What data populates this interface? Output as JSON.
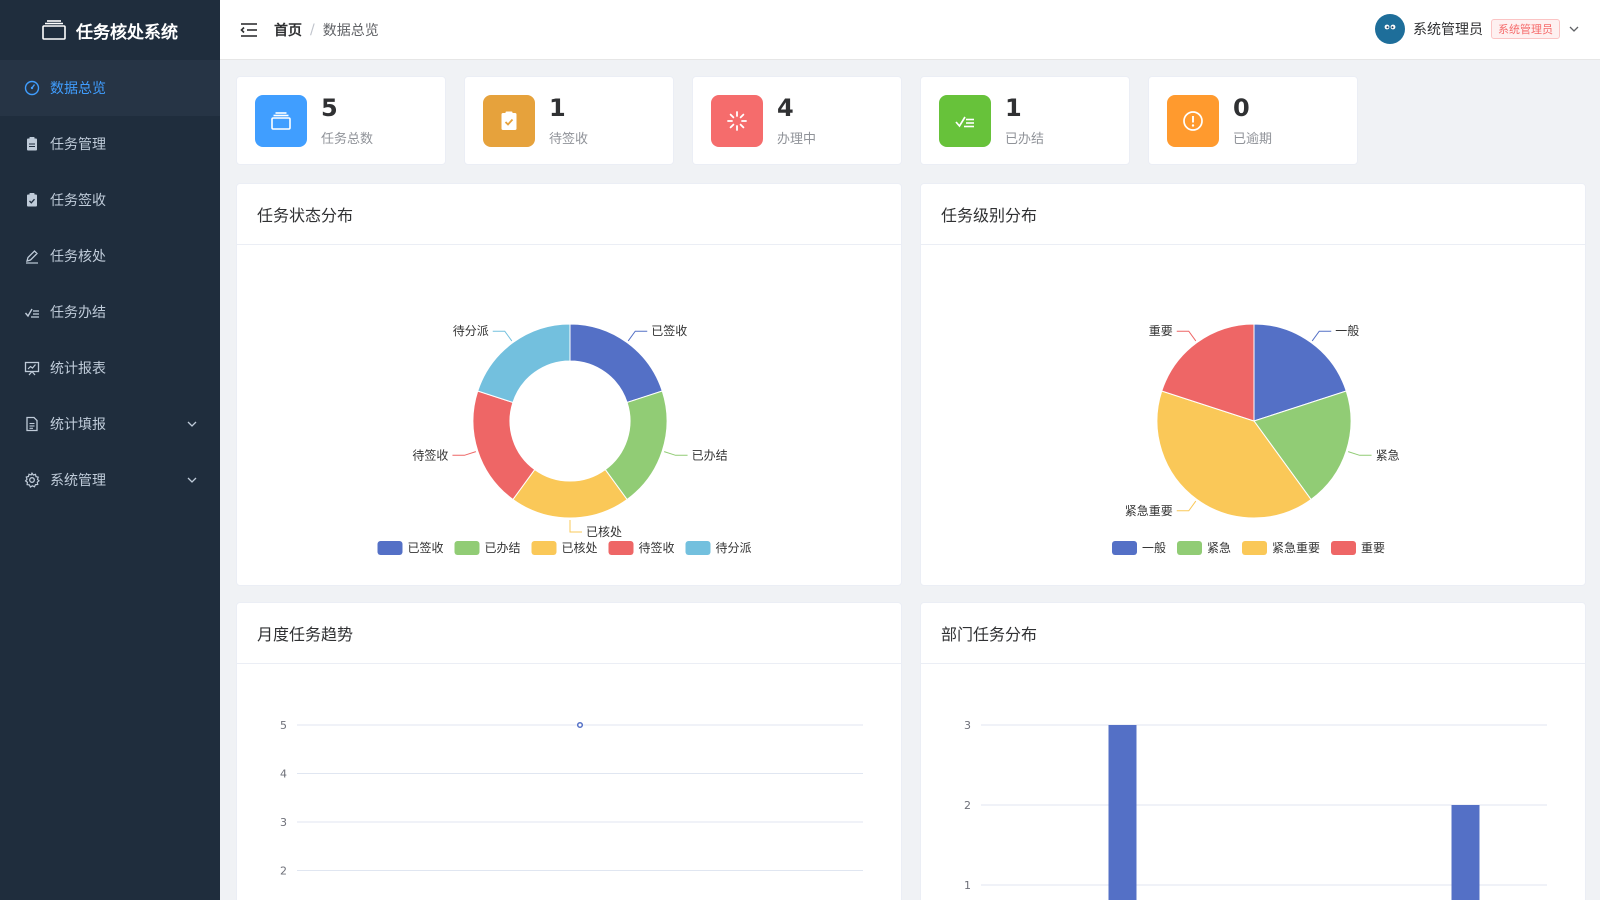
{
  "app": {
    "title": "任务核处系统"
  },
  "sidebar": {
    "items": [
      {
        "label": "数据总览",
        "icon": "dashboard-icon",
        "active": true
      },
      {
        "label": "任务管理",
        "icon": "clipboard-icon"
      },
      {
        "label": "任务签收",
        "icon": "clipboard-check-icon"
      },
      {
        "label": "任务核处",
        "icon": "edit-pen-icon"
      },
      {
        "label": "任务办结",
        "icon": "checklist-icon"
      },
      {
        "label": "统计报表",
        "icon": "presentation-chart-icon"
      },
      {
        "label": "统计填报",
        "icon": "document-icon",
        "expandable": true
      },
      {
        "label": "系统管理",
        "icon": "gear-icon",
        "expandable": true
      }
    ]
  },
  "header": {
    "breadcrumb": {
      "home": "首页",
      "separator": "/",
      "current": "数据总览"
    },
    "user": {
      "name": "系统管理员",
      "role": "系统管理员"
    }
  },
  "stats": [
    {
      "value": "5",
      "label": "任务总数",
      "color": "#409eff",
      "icon": "layers-icon"
    },
    {
      "value": "1",
      "label": "待签收",
      "color": "#e6a23c",
      "icon": "clipboard-check-icon"
    },
    {
      "value": "4",
      "label": "办理中",
      "color": "#f56c6c",
      "icon": "loading-icon"
    },
    {
      "value": "1",
      "label": "已办结",
      "color": "#67c23a",
      "icon": "checklist-icon"
    },
    {
      "value": "0",
      "label": "已逾期",
      "color": "#ff9a2e",
      "icon": "warning-icon"
    }
  ],
  "panels": {
    "status": "任务状态分布",
    "level": "任务级别分布",
    "monthly": "月度任务趋势",
    "dept": "部门任务分布"
  },
  "chart_data": [
    {
      "type": "pie",
      "donut": true,
      "title": "任务状态分布",
      "categories": [
        "已签收",
        "已办结",
        "已核处",
        "待签收",
        "待分派"
      ],
      "values": [
        1,
        1,
        1,
        1,
        1
      ],
      "colors": [
        "#5470c6",
        "#91cc75",
        "#fac858",
        "#ee6666",
        "#73c0de"
      ],
      "legend": "bottom"
    },
    {
      "type": "pie",
      "title": "任务级别分布",
      "categories": [
        "一般",
        "紧急",
        "紧急重要",
        "重要"
      ],
      "values": [
        1,
        1,
        2,
        1
      ],
      "colors": [
        "#5470c6",
        "#91cc75",
        "#fac858",
        "#ee6666"
      ],
      "legend": "bottom"
    },
    {
      "type": "line",
      "title": "月度任务趋势",
      "y_ticks": [
        2,
        3,
        4,
        5
      ],
      "points": [
        {
          "y": 5
        }
      ],
      "color": "#5470c6",
      "grid": true
    },
    {
      "type": "bar",
      "title": "部门任务分布",
      "y_ticks": [
        1,
        2,
        3
      ],
      "values": [
        3,
        2
      ],
      "color": "#5470c6",
      "grid": true
    }
  ]
}
